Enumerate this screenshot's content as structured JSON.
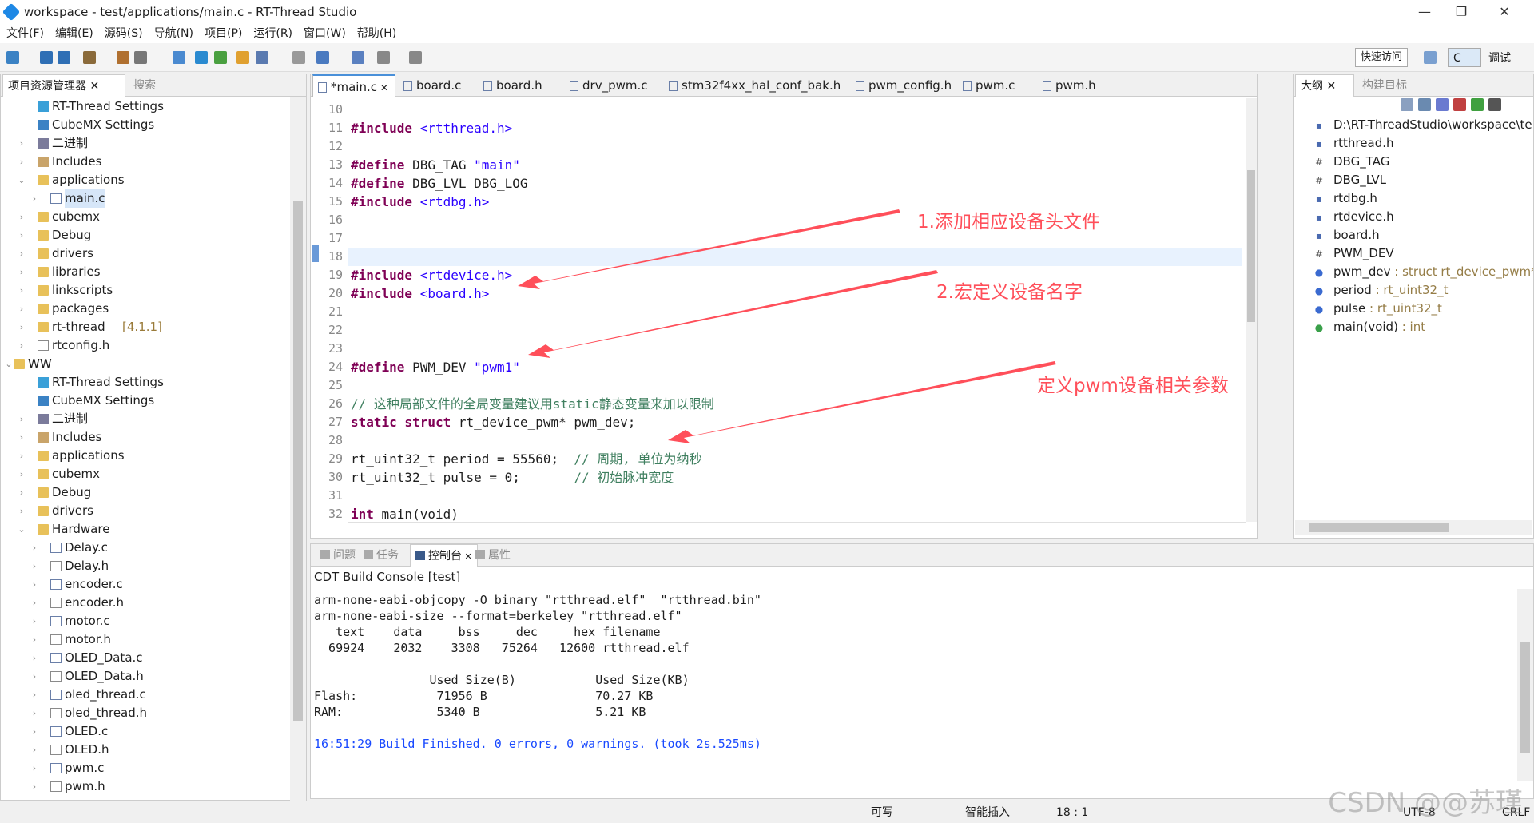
{
  "window": {
    "title": "workspace - test/applications/main.c - RT-Thread Studio"
  },
  "menu": [
    "文件(F)",
    "编辑(E)",
    "源码(S)",
    "导航(N)",
    "项目(P)",
    "运行(R)",
    "窗口(W)",
    "帮助(H)"
  ],
  "toolbar": {
    "quick_access": "快速访问",
    "perspective_c": "C",
    "perspective_debug": "调试"
  },
  "project_explorer": {
    "tab_label": "项目资源管理器",
    "search_tab": "搜索",
    "items": [
      {
        "label": "RT-Thread Settings",
        "icon": "rt-icon",
        "indent": 1,
        "arrow": ""
      },
      {
        "label": "CubeMX Settings",
        "icon": "mx-icon",
        "indent": 1,
        "arrow": ""
      },
      {
        "label": "二进制",
        "icon": "binary-icon",
        "indent": 1,
        "arrow": ">"
      },
      {
        "label": "Includes",
        "icon": "includes-icon",
        "indent": 1,
        "arrow": ">"
      },
      {
        "label": "applications",
        "icon": "folder-icon",
        "indent": 1,
        "arrow": "v"
      },
      {
        "label": "main.c",
        "icon": "c-file-icon",
        "indent": 2,
        "arrow": ">",
        "selected": true
      },
      {
        "label": "cubemx",
        "icon": "folder-icon",
        "indent": 1,
        "arrow": ">"
      },
      {
        "label": "Debug",
        "icon": "folder-icon",
        "indent": 1,
        "arrow": ">"
      },
      {
        "label": "drivers",
        "icon": "folder-icon",
        "indent": 1,
        "arrow": ">"
      },
      {
        "label": "libraries",
        "icon": "folder-icon",
        "indent": 1,
        "arrow": ">"
      },
      {
        "label": "linkscripts",
        "icon": "folder-icon",
        "indent": 1,
        "arrow": ">"
      },
      {
        "label": "packages",
        "icon": "folder-icon",
        "indent": 1,
        "arrow": ">"
      },
      {
        "label": "rt-thread",
        "icon": "folder-icon",
        "indent": 1,
        "arrow": ">",
        "suffix": " [4.1.1]"
      },
      {
        "label": "rtconfig.h",
        "icon": "h-file-icon",
        "indent": 1,
        "arrow": ">"
      },
      {
        "label": "WW",
        "icon": "project-icon",
        "indent": 0,
        "arrow": "v"
      },
      {
        "label": "RT-Thread Settings",
        "icon": "rt-icon",
        "indent": 1,
        "arrow": ""
      },
      {
        "label": "CubeMX Settings",
        "icon": "mx-icon",
        "indent": 1,
        "arrow": ""
      },
      {
        "label": "二进制",
        "icon": "binary-icon",
        "indent": 1,
        "arrow": ">"
      },
      {
        "label": "Includes",
        "icon": "includes-icon",
        "indent": 1,
        "arrow": ">"
      },
      {
        "label": "applications",
        "icon": "folder-icon",
        "indent": 1,
        "arrow": ">"
      },
      {
        "label": "cubemx",
        "icon": "folder-icon",
        "indent": 1,
        "arrow": ">"
      },
      {
        "label": "Debug",
        "icon": "folder-icon",
        "indent": 1,
        "arrow": ">"
      },
      {
        "label": "drivers",
        "icon": "folder-icon",
        "indent": 1,
        "arrow": ">"
      },
      {
        "label": "Hardware",
        "icon": "folder-icon",
        "indent": 1,
        "arrow": "v"
      },
      {
        "label": "Delay.c",
        "icon": "c-file-icon",
        "indent": 2,
        "arrow": ">"
      },
      {
        "label": "Delay.h",
        "icon": "h-file-icon",
        "indent": 2,
        "arrow": ">"
      },
      {
        "label": "encoder.c",
        "icon": "c-file-icon",
        "indent": 2,
        "arrow": ">"
      },
      {
        "label": "encoder.h",
        "icon": "h-file-icon",
        "indent": 2,
        "arrow": ">"
      },
      {
        "label": "motor.c",
        "icon": "c-file-icon",
        "indent": 2,
        "arrow": ">"
      },
      {
        "label": "motor.h",
        "icon": "h-file-icon",
        "indent": 2,
        "arrow": ">"
      },
      {
        "label": "OLED_Data.c",
        "icon": "c-file-icon",
        "indent": 2,
        "arrow": ">"
      },
      {
        "label": "OLED_Data.h",
        "icon": "h-file-icon",
        "indent": 2,
        "arrow": ">"
      },
      {
        "label": "oled_thread.c",
        "icon": "c-file-icon",
        "indent": 2,
        "arrow": ">"
      },
      {
        "label": "oled_thread.h",
        "icon": "h-file-icon",
        "indent": 2,
        "arrow": ">"
      },
      {
        "label": "OLED.c",
        "icon": "c-file-icon",
        "indent": 2,
        "arrow": ">"
      },
      {
        "label": "OLED.h",
        "icon": "h-file-icon",
        "indent": 2,
        "arrow": ">"
      },
      {
        "label": "pwm.c",
        "icon": "c-file-icon",
        "indent": 2,
        "arrow": ">"
      },
      {
        "label": "pwm.h",
        "icon": "h-file-icon",
        "indent": 2,
        "arrow": ">"
      }
    ]
  },
  "editor": {
    "tabs": [
      "*main.c",
      "board.c",
      "board.h",
      "drv_pwm.c",
      "stm32f4xx_hal_conf_bak.h",
      "pwm_config.h",
      "pwm.c",
      "pwm.h"
    ],
    "lines": [
      {
        "n": "10",
        "segs": []
      },
      {
        "n": "11",
        "segs": [
          [
            "pp",
            "#include "
          ],
          [
            "str",
            "<rtthread.h>"
          ]
        ]
      },
      {
        "n": "12",
        "segs": []
      },
      {
        "n": "13",
        "segs": [
          [
            "pp",
            "#define "
          ],
          [
            "",
            "DBG_TAG "
          ],
          [
            "str",
            "\"main\""
          ]
        ]
      },
      {
        "n": "14",
        "segs": [
          [
            "pp",
            "#define "
          ],
          [
            "",
            "DBG_LVL DBG_LOG"
          ]
        ]
      },
      {
        "n": "15",
        "segs": [
          [
            "pp",
            "#include "
          ],
          [
            "str",
            "<rtdbg.h>"
          ]
        ]
      },
      {
        "n": "16",
        "segs": []
      },
      {
        "n": "17",
        "segs": []
      },
      {
        "n": "18",
        "segs": [],
        "current": true
      },
      {
        "n": "19",
        "segs": [
          [
            "pp",
            "#include "
          ],
          [
            "str",
            "<rtdevice.h>"
          ]
        ]
      },
      {
        "n": "20",
        "segs": [
          [
            "pp",
            "#include "
          ],
          [
            "str",
            "<board.h>"
          ]
        ]
      },
      {
        "n": "21",
        "segs": []
      },
      {
        "n": "22",
        "segs": []
      },
      {
        "n": "23",
        "segs": []
      },
      {
        "n": "24",
        "segs": [
          [
            "pp",
            "#define "
          ],
          [
            "",
            "PWM_DEV "
          ],
          [
            "str",
            "\"pwm1\""
          ]
        ]
      },
      {
        "n": "25",
        "segs": []
      },
      {
        "n": "26",
        "segs": [
          [
            "cm",
            "// 这种局部文件的全局变量建议用static静态变量来加以限制"
          ]
        ]
      },
      {
        "n": "27",
        "segs": [
          [
            "kw",
            "static struct "
          ],
          [
            "",
            "rt_device_pwm* pwm_dev;"
          ]
        ]
      },
      {
        "n": "28",
        "segs": []
      },
      {
        "n": "29",
        "segs": [
          [
            "",
            "rt_uint32_t period = 55560;  "
          ],
          [
            "cm",
            "// 周期, 单位为纳秒"
          ]
        ]
      },
      {
        "n": "30",
        "segs": [
          [
            "",
            "rt_uint32_t pulse = 0;       "
          ],
          [
            "cm",
            "// 初始脉冲宽度"
          ]
        ]
      },
      {
        "n": "31",
        "segs": []
      },
      {
        "n": "32",
        "segs": [
          [
            "kw",
            "int "
          ],
          [
            "",
            "main(void)"
          ]
        ]
      }
    ]
  },
  "annotations": {
    "a1": "1.添加相应设备头文件",
    "a2": "2.宏定义设备名字",
    "a3": "定义pwm设备相关参数"
  },
  "outline": {
    "tab_label": "大纲",
    "build_tab": "构建目标",
    "items": [
      {
        "icon": "h",
        "text": "D:\\RT-ThreadStudio\\workspace\\te",
        "type": ""
      },
      {
        "icon": "h",
        "text": "rtthread.h",
        "type": ""
      },
      {
        "icon": "#",
        "text": "DBG_TAG",
        "type": ""
      },
      {
        "icon": "#",
        "text": "DBG_LVL",
        "type": ""
      },
      {
        "icon": "h",
        "text": "rtdbg.h",
        "type": ""
      },
      {
        "icon": "h",
        "text": "rtdevice.h",
        "type": ""
      },
      {
        "icon": "h",
        "text": "board.h",
        "type": ""
      },
      {
        "icon": "#",
        "text": "PWM_DEV",
        "type": ""
      },
      {
        "icon": "s",
        "text": "pwm_dev",
        "type": " : struct rt_device_pwm*"
      },
      {
        "icon": "o",
        "text": "period",
        "type": " : rt_uint32_t"
      },
      {
        "icon": "o",
        "text": "pulse",
        "type": " : rt_uint32_t"
      },
      {
        "icon": "g",
        "text": "main(void)",
        "type": " : int"
      }
    ]
  },
  "console": {
    "tabs": [
      "问题",
      "任务",
      "控制台",
      "属性"
    ],
    "title": "CDT Build Console [test]",
    "lines": [
      "arm-none-eabi-objcopy -O binary \"rtthread.elf\"  \"rtthread.bin\"",
      "arm-none-eabi-size --format=berkeley \"rtthread.elf\"",
      "   text    data     bss     dec     hex filename",
      "  69924    2032    3308   75264   12600 rtthread.elf",
      "",
      "                Used Size(B)           Used Size(KB)",
      "Flash:           71956 B               70.27 KB",
      "RAM:             5340 B                5.21 KB",
      "",
      "16:51:29 Build Finished. 0 errors, 0 warnings. (took 2s.525ms)"
    ]
  },
  "status": {
    "writable": "可写",
    "insert": "智能插入",
    "pos": "18 : 1",
    "encoding": "UTF-8",
    "eol": "CRLF"
  },
  "watermark": "CSDN @@苏瑾"
}
